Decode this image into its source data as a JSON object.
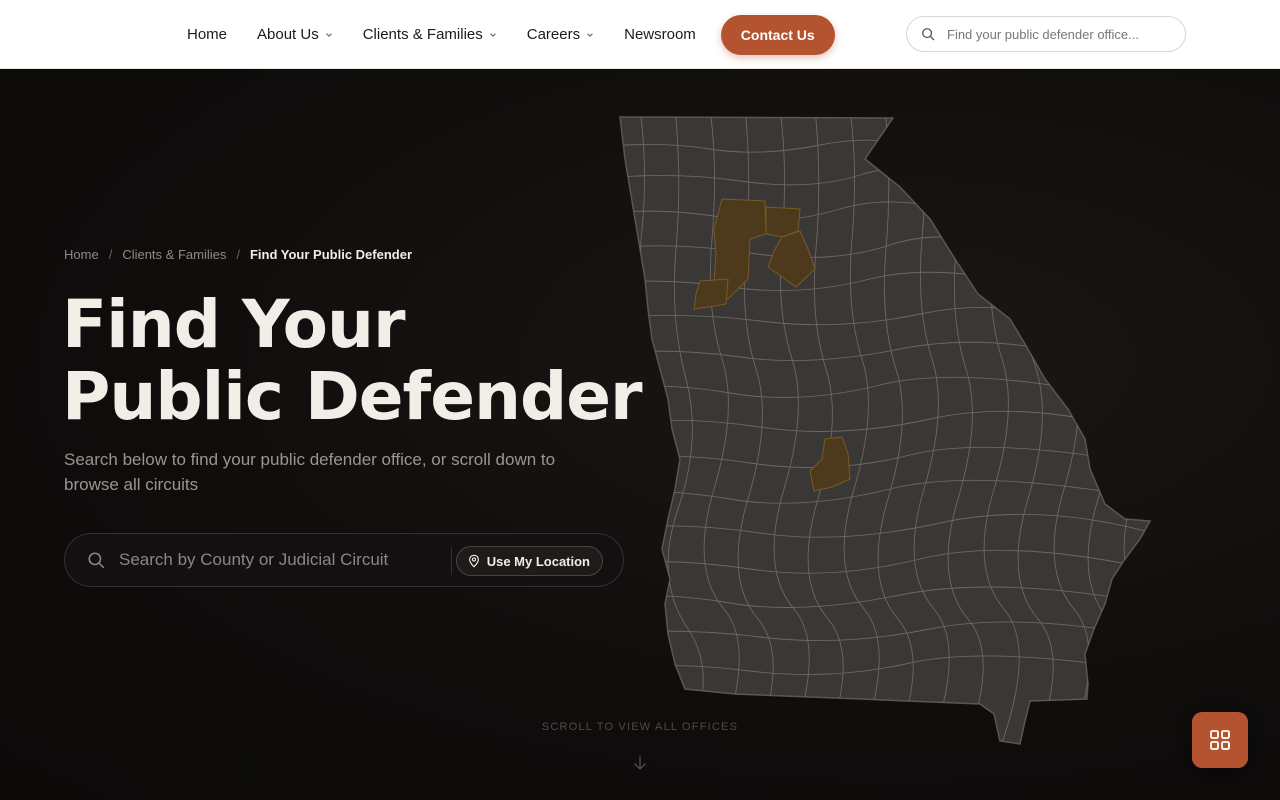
{
  "nav": {
    "items": [
      {
        "label": "Home",
        "has_dropdown": false
      },
      {
        "label": "About Us",
        "has_dropdown": true
      },
      {
        "label": "Clients & Families",
        "has_dropdown": true
      },
      {
        "label": "Careers",
        "has_dropdown": true
      },
      {
        "label": "Newsroom",
        "has_dropdown": false
      }
    ],
    "contact_label": "Contact Us",
    "search_placeholder": "Find your public defender office..."
  },
  "breadcrumb": {
    "items": [
      "Home",
      "Clients & Families"
    ],
    "current": "Find Your Public Defender"
  },
  "hero": {
    "title_line1": "Find Your",
    "title_line2": "Public Defender",
    "subtitle": "Search below to find your public defender office, or scroll down to browse all circuits",
    "search_placeholder": "Search by County or Judicial Circuit",
    "location_button": "Use My Location",
    "scroll_hint": "SCROLL TO VIEW ALL OFFICES"
  },
  "map": {
    "name": "georgia-county-map",
    "base_color": "#3a3836",
    "border_color": "#6c6864",
    "highlight_color": "#4d3a1c",
    "highlight_border": "#7a5a26"
  },
  "icons": {
    "header_search": "search-icon",
    "hero_search": "search-icon",
    "location": "map-pin-icon",
    "scroll": "arrow-down-icon",
    "fab": "grid-icon"
  },
  "colors": {
    "accent": "#b4532f",
    "background": "#0f0d0c",
    "text": "#f2ede6"
  }
}
